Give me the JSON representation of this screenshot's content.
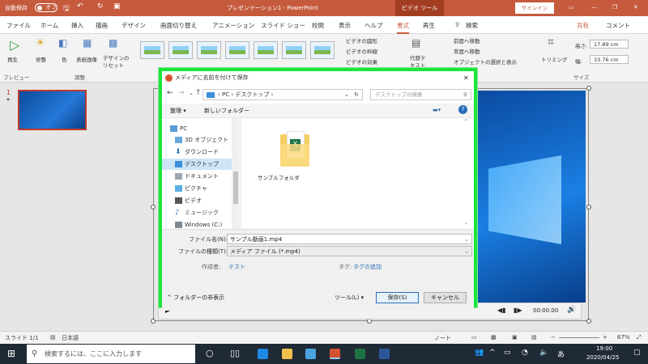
{
  "titlebar": {
    "autosave": "自動保存",
    "autosave_state": "オフ",
    "doc_title": "プレゼンテーション1 - PowerPoint",
    "context_tab": "ビデオ ツール",
    "signin": "サインイン"
  },
  "tabs": [
    "ファイル",
    "ホーム",
    "挿入",
    "描画",
    "デザイン",
    "画面切り替え",
    "アニメーション",
    "スライド ショー",
    "校閲",
    "表示",
    "ヘルプ",
    "書式",
    "再生",
    "検索"
  ],
  "tab_active": "書式",
  "share": "共有",
  "comment": "コメント",
  "ribbon": {
    "play": "再生",
    "correct": "修整",
    "color": "色",
    "poster": "表紙画像",
    "reset": "デザインの",
    "reset2": "リセット",
    "shape": "ビデオの図形",
    "border": "ビデオの枠線",
    "effect": "ビデオの効果",
    "alt": "代替テ",
    "alt2": "キスト",
    "front": "前面へ移動",
    "back": "背面へ移動",
    "pane": "オブジェクトの選択と表示",
    "trim": "トリミング",
    "height_label": "高さ:",
    "height": "17.89 cm",
    "width_label": "幅:",
    "width": "33.76 cm",
    "group_preview": "プレビュー",
    "group_adjust": "調整",
    "group_size": "サイズ"
  },
  "slidepanel": {
    "num": "1",
    "star": "*"
  },
  "video": {
    "time": "00:00.00"
  },
  "dialog": {
    "title": "メディアに名前を付けて保存",
    "path_pc": "PC",
    "path_desktop": "デスクトップ",
    "search_placeholder": "デスクトップの検索",
    "organize": "整理 ▾",
    "newfolder": "新しいフォルダー",
    "nav": [
      "PC",
      "3D オブジェクト",
      "ダウンロード",
      "デスクトップ",
      "ドキュメント",
      "ピクチャ",
      "ビデオ",
      "ミュージック",
      "Windows (C:)"
    ],
    "nav_selected": "デスクトップ",
    "folder_name": "サンプルフォルダ",
    "filename_label": "ファイル名(N):",
    "filename": "サンプル動画1.mp4",
    "filetype_label": "ファイルの種類(T):",
    "filetype": "メディア ファイル (*.mp4)",
    "author_label": "作成者:",
    "author": "テスト",
    "tags_label": "タグ:",
    "tags": "タグの追加",
    "hide_folders": "フォルダーの非表示",
    "tools": "ツール(L)",
    "save": "保存(S)",
    "cancel": "キャンセル"
  },
  "statusbar": {
    "slide": "スライド 1/1",
    "lang": "日本語",
    "notes": "ノート",
    "zoom": "67%"
  },
  "taskbar": {
    "search": "検索するには、ここに入力します",
    "ime": "あ",
    "time": "19:00",
    "date": "2020/04/25"
  },
  "colors": {
    "accent": "#c55a3c",
    "dialog_border": "#19e63a",
    "link": "#2a6ebb"
  }
}
